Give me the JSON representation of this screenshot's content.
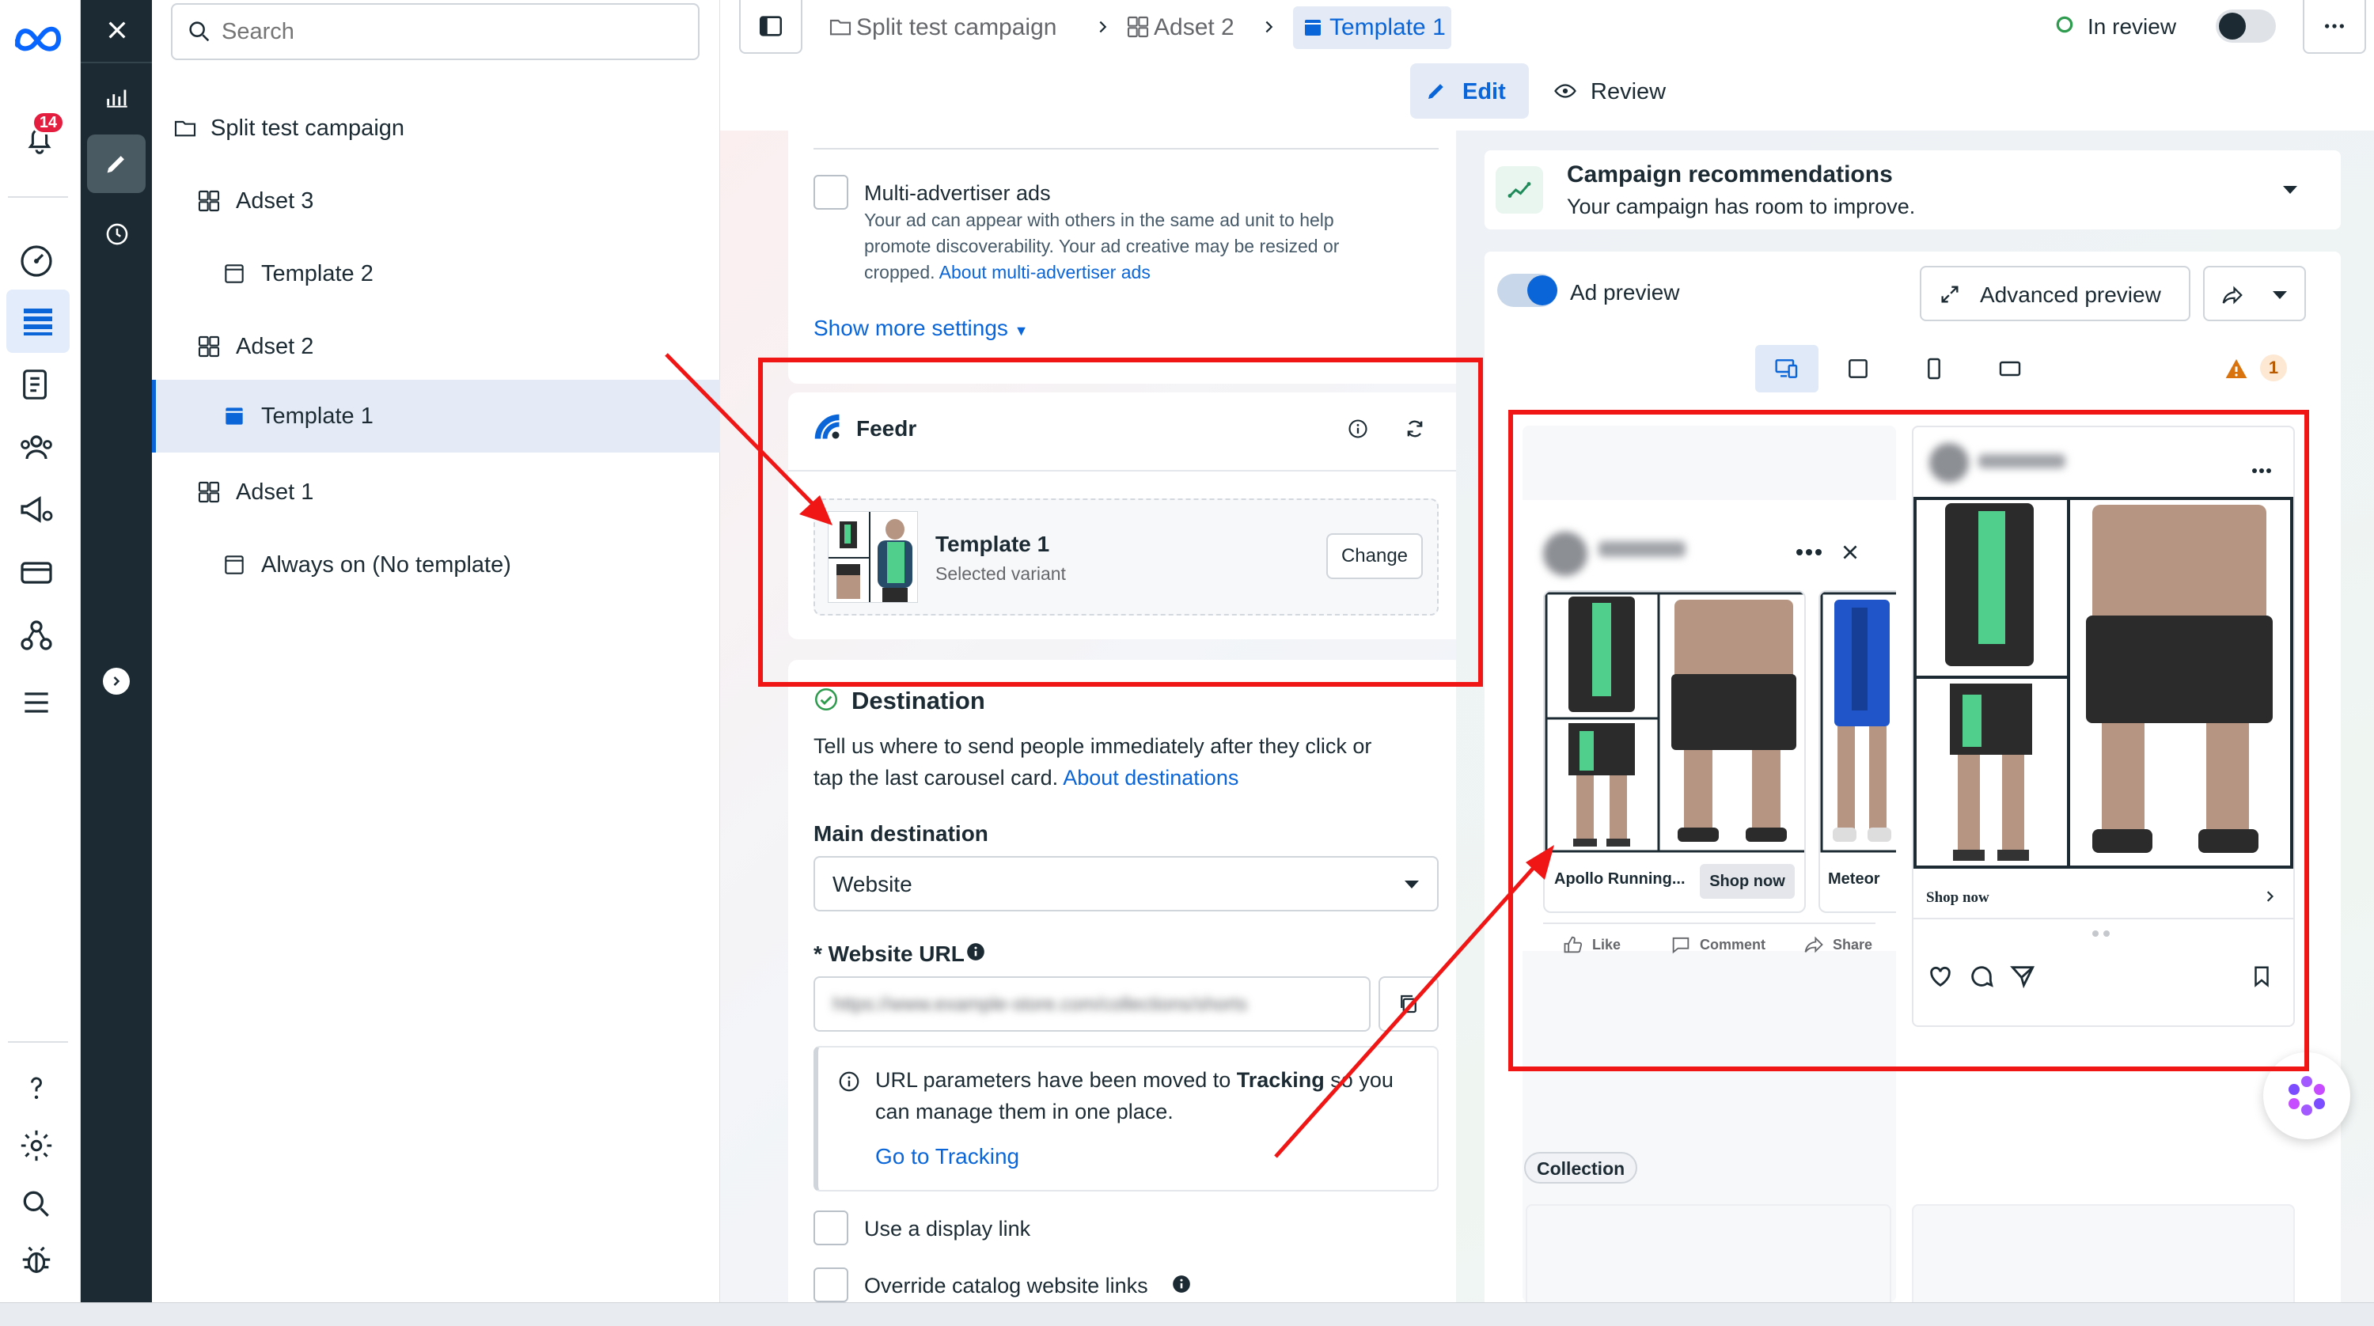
{
  "search": {
    "placeholder": "Search"
  },
  "notifications": {
    "count": "14"
  },
  "tree": {
    "items": [
      {
        "label": "Split test campaign",
        "icon": "folder-icon"
      },
      {
        "label": "Adset 3",
        "icon": "grid-icon"
      },
      {
        "label": "Template 2",
        "icon": "template-icon"
      },
      {
        "label": "Adset 2",
        "icon": "grid-icon"
      },
      {
        "label": "Template 1",
        "icon": "template-icon",
        "selected": true
      },
      {
        "label": "Adset 1",
        "icon": "grid-icon"
      },
      {
        "label": "Always on (No template)",
        "icon": "template-icon"
      }
    ]
  },
  "breadcrumb": {
    "campaign": "Split test campaign",
    "adset": "Adset 2",
    "template": "Template 1"
  },
  "status": {
    "label": "In review"
  },
  "modes": {
    "edit": "Edit",
    "review": "Review"
  },
  "editor": {
    "multi_adv": {
      "title": "Multi-advertiser ads",
      "desc_line1": "Your ad can appear with others in the same ad unit to help",
      "desc_line2": "promote discoverability. Your ad creative may be resized or",
      "desc_line3": "cropped.",
      "link": "About multi-advertiser ads"
    },
    "show_more": "Show more settings",
    "feedr": {
      "brand": "Feedr",
      "template_name": "Template 1",
      "template_sub": "Selected variant",
      "change": "Change"
    },
    "destination": {
      "title": "Destination",
      "desc_line1": "Tell us where to send people immediately after they click or",
      "desc_line2": "tap the last carousel card.",
      "link": "About destinations",
      "main_label": "Main destination",
      "main_value": "Website",
      "url_label": "* Website URL",
      "url_value": "https://www.example-store.com/collections/shorts",
      "info_line1_a": "URL parameters have been moved to ",
      "info_line1_b": "Tracking",
      "info_line1_c": " so you",
      "info_line2": "can manage them in one place.",
      "info_link": "Go to Tracking",
      "display_link": "Use a display link",
      "override_links": "Override catalog website links"
    }
  },
  "recommendations": {
    "title": "Campaign recommendations",
    "sub": "Your campaign has room to improve."
  },
  "preview": {
    "label": "Ad preview",
    "advanced": "Advanced preview",
    "warning_count": "1",
    "fb": {
      "card1_title": "Apollo Running...",
      "card1_cta": "Shop now",
      "card2_title": "Meteor",
      "like": "Like",
      "comment": "Comment",
      "share": "Share"
    },
    "ig": {
      "cta": "Shop now"
    },
    "collection_badge": "Collection"
  },
  "colors": {
    "accent": "#0a66d8",
    "dark_rail": "#1c2b33",
    "annotation_red": "#f01616",
    "green": "#2e9b4f",
    "short_accent": "#4fcf8b"
  }
}
